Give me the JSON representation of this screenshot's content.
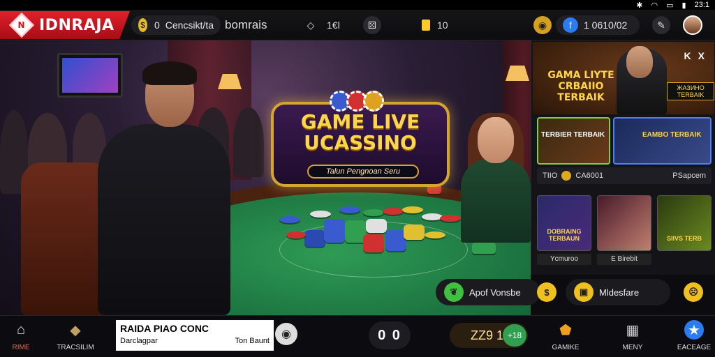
{
  "status_bar": {
    "time": "23:1"
  },
  "brand": {
    "name": "IDNRAJA",
    "logo_letter": "N"
  },
  "topbar": {
    "coin_pill": {
      "prefix": "0",
      "label": "Cencsikt/ta"
    },
    "bonus_label": "bomrais",
    "gems_value": "1€l",
    "tickets_value": "10",
    "balance_value": "1 0610/02"
  },
  "scene": {
    "sign_title_line1": "GAME LIVE",
    "sign_title_line2": "UCASSINO",
    "sign_subtitle": "Talun Pengnoan Seru"
  },
  "panel": {
    "promo_title": "GAMA LIYTE CRBAIIO TERBAIK",
    "promo_badge": "ЖАЗИНО TERBAIK",
    "close_labels": [
      "K",
      "X"
    ],
    "mini_card_1": "TERBIER TERBAIK",
    "mini_card_2": "EAMBO TERBAIK",
    "strip_left_prefix": "TIIO",
    "strip_left_value": "CA6001",
    "strip_right": "PSapcem",
    "tiles": [
      {
        "label": "DOBRAING TERBAUN",
        "caption": "Ycmuroo"
      },
      {
        "label": "",
        "caption": "E Birebit"
      },
      {
        "label": "SIIVS TERB",
        "caption": ""
      }
    ]
  },
  "actions": {
    "apply": "Apof Vonsbe",
    "mobile": "Mldesfare"
  },
  "bottom_nav": {
    "home": "RIME",
    "tracking": "TRACSILIM",
    "games": "GAMIKE",
    "menu": "MENY",
    "garage": "EACEAGE"
  },
  "ticker": {
    "title": "RAIDA PIAO CONC",
    "left": "Darclagpar",
    "right": "Ton Baunt"
  },
  "score_value": "0 0",
  "wallet": {
    "value": "ZZ9 1",
    "plus_label": "+18"
  },
  "colors": {
    "brand_red": "#d0141e",
    "gold": "#ffd54a",
    "felt_green": "#1f8046",
    "accent_green": "#30a050",
    "accent_blue": "#2a7cf0"
  }
}
